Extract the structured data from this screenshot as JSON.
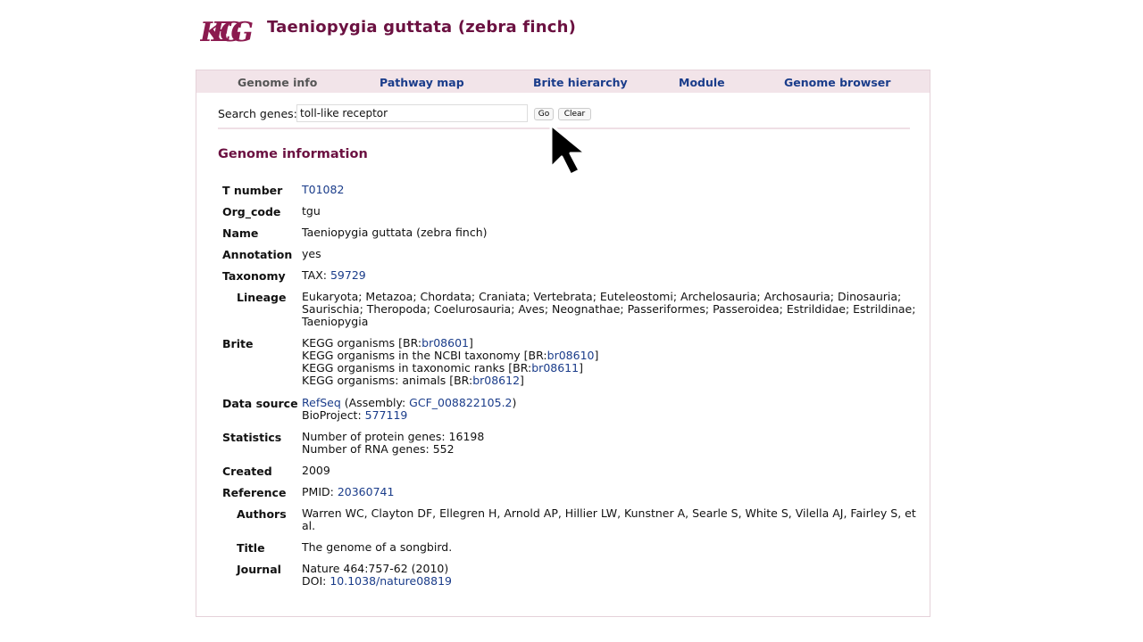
{
  "header": {
    "logo_text": "KEGG",
    "title": "Taeniopygia guttata (zebra finch)"
  },
  "nav": {
    "items": [
      {
        "label": "Genome info"
      },
      {
        "label": "Pathway map"
      },
      {
        "label": "Brite hierarchy"
      },
      {
        "label": "Module"
      },
      {
        "label": "Genome browser"
      }
    ]
  },
  "search": {
    "label": "Search genes:",
    "value": "toll-like receptor",
    "go_label": "Go",
    "clear_label": "Clear"
  },
  "section_title": "Genome information",
  "info": {
    "t_number": {
      "label": "T number",
      "value": "T01082"
    },
    "org_code": {
      "label": "Org_code",
      "value": "tgu"
    },
    "name": {
      "label": "Name",
      "value": "Taeniopygia guttata (zebra finch)"
    },
    "annotation": {
      "label": "Annotation",
      "value": "yes"
    },
    "taxonomy": {
      "label": "Taxonomy",
      "prefix": "TAX: ",
      "id": "59729"
    },
    "lineage": {
      "label": "Lineage",
      "lines": [
        "Eukaryota; Metazoa; Chordata; Craniata; Vertebrata; Euteleostomi; Archelosauria; Archosauria; Dinosauria;",
        "Saurischia; Theropoda; Coelurosauria; Aves; Neognathae; Passeriformes; Passeroidea; Estrildidae; Estrildinae;",
        "Taeniopygia"
      ]
    },
    "brite": {
      "label": "Brite",
      "entries": [
        {
          "text": "KEGG organisms [BR:",
          "link": "br08601",
          "suffix": "]"
        },
        {
          "text": "KEGG organisms in the NCBI taxonomy [BR:",
          "link": "br08610",
          "suffix": "]"
        },
        {
          "text": "KEGG organisms in taxonomic ranks [BR:",
          "link": "br08611",
          "suffix": "]"
        },
        {
          "text": "KEGG organisms: animals [BR:",
          "link": "br08612",
          "suffix": "]"
        }
      ]
    },
    "data_source": {
      "label": "Data source",
      "source": "RefSeq",
      "assembly_prefix": " (Assembly: ",
      "assembly": "GCF_008822105.2",
      "assembly_suffix": ")",
      "bioproject_prefix": "BioProject: ",
      "bioproject": "577119"
    },
    "statistics": {
      "label": "Statistics",
      "lines": [
        "Number of protein genes: 16198",
        "Number of RNA genes: 552"
      ]
    },
    "created": {
      "label": "Created",
      "value": "2009"
    },
    "reference": {
      "label": "Reference",
      "prefix": "PMID: ",
      "pmid": "20360741"
    },
    "authors": {
      "label": "Authors",
      "lines": [
        "Warren WC, Clayton DF, Ellegren H, Arnold AP, Hillier LW, Kunstner A, Searle S, White S, Vilella AJ, Fairley S, et",
        "al."
      ]
    },
    "title": {
      "label": "Title",
      "value": "The genome of a songbird."
    },
    "journal": {
      "label": "Journal",
      "value": "Nature 464:757-62 (2010)",
      "doi_prefix": "DOI: ",
      "doi": "10.1038/nature08819"
    }
  },
  "colors": {
    "brand": "#6b1141",
    "link": "#1a3c8a",
    "nav_bg": "#f2e4e9"
  },
  "icons": {
    "cursor": "mouse-pointer-icon"
  }
}
